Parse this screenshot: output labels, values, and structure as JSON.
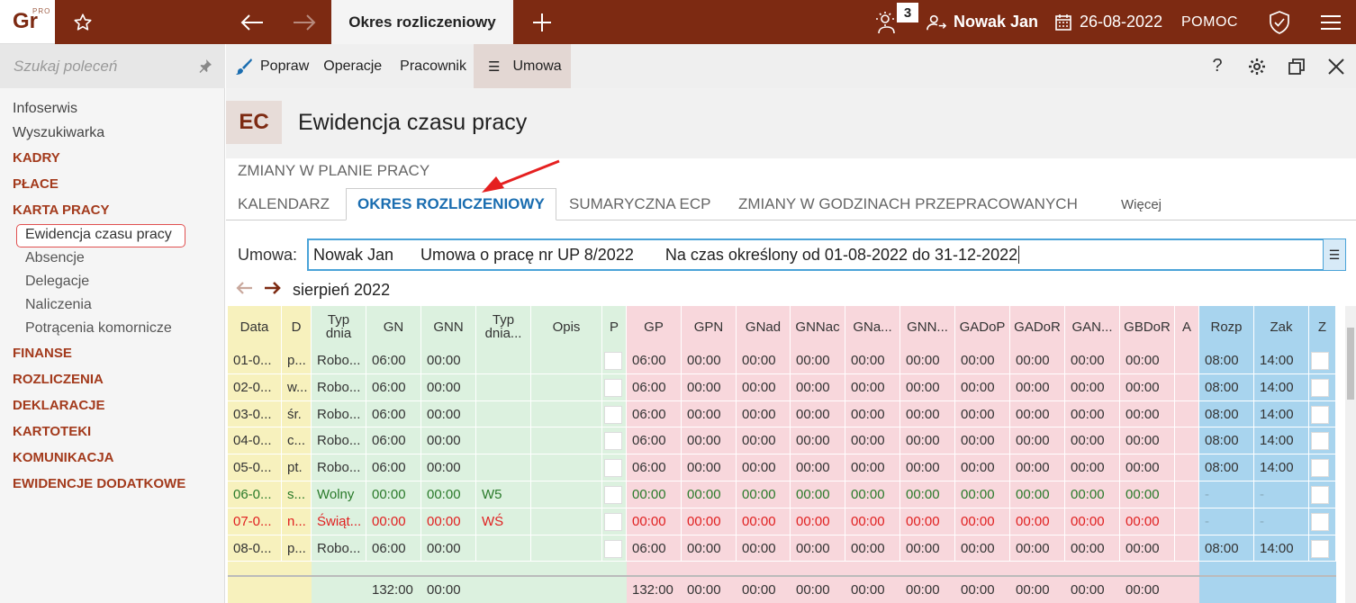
{
  "app": {
    "logo_text": "Gr",
    "logo_badge": "PRO",
    "active_tab": "Okres rozliczeniowy",
    "notifications": "3",
    "user": "Nowak Jan",
    "date": "26-08-2022",
    "help": "POMOC"
  },
  "sidebar": {
    "search_placeholder": "Szukaj poleceń",
    "items": [
      {
        "label": "Infoserwis",
        "kind": "plain"
      },
      {
        "label": "Wyszukiwarka",
        "kind": "plain"
      },
      {
        "label": "KADRY",
        "kind": "sect"
      },
      {
        "label": "PŁACE",
        "kind": "sect"
      },
      {
        "label": "KARTA PRACY",
        "kind": "sect"
      },
      {
        "label": "Ewidencja czasu pracy",
        "kind": "sel"
      },
      {
        "label": "Absencje",
        "kind": "sub"
      },
      {
        "label": "Delegacje",
        "kind": "sub"
      },
      {
        "label": "Naliczenia",
        "kind": "sub"
      },
      {
        "label": "Potrącenia komornicze",
        "kind": "sub"
      },
      {
        "label": "FINANSE",
        "kind": "sect"
      },
      {
        "label": "ROZLICZENIA",
        "kind": "sect"
      },
      {
        "label": "DEKLARACJE",
        "kind": "sect"
      },
      {
        "label": "KARTOTEKI",
        "kind": "sect"
      },
      {
        "label": "KOMUNIKACJA",
        "kind": "sect"
      },
      {
        "label": "EWIDENCJE DODATKOWE",
        "kind": "sect"
      }
    ]
  },
  "toolbar": {
    "popraw": "Popraw",
    "operacje": "Operacje",
    "pracownik": "Pracownik",
    "umowa": "Umowa",
    "help": "?"
  },
  "header": {
    "badge": "EC",
    "title": "Ewidencja czasu pracy"
  },
  "subtabs": {
    "zmiany_plan": "ZMIANY W PLANIE PRACY",
    "kalendarz": "KALENDARZ",
    "okres": "OKRES ROZLICZENIOWY",
    "sumaryczna": "SUMARYCZNA ECP",
    "zmiany_godz": "ZMIANY W GODZINACH PRZEPRACOWANYCH",
    "wiecej": "Więcej"
  },
  "umowa": {
    "label": "Umowa:",
    "value": "Nowak Jan      Umowa o pracę nr UP 8/2022       Na czas określony od 01-08-2022 do 31-12-2022"
  },
  "month": "sierpień 2022",
  "colors": {
    "yellow": "#f7f1bd",
    "green": "#dcf1df",
    "pink": "#f8d7dc",
    "blue": "#a8d4ee",
    "holiday_text": "#e02020",
    "free_text": "#2a7a2a"
  },
  "columns": [
    {
      "key": "data",
      "label": "Data",
      "w": 60,
      "bg": "yellow"
    },
    {
      "key": "d",
      "label": "D",
      "w": 33,
      "bg": "yellow"
    },
    {
      "key": "typ",
      "label": "Typ\ndnia",
      "w": 61,
      "bg": "green"
    },
    {
      "key": "gn",
      "label": "GN",
      "w": 61,
      "bg": "green"
    },
    {
      "key": "gnn",
      "label": "GNN",
      "w": 61,
      "bg": "green"
    },
    {
      "key": "typ2",
      "label": "Typ\ndnia...",
      "w": 61,
      "bg": "green"
    },
    {
      "key": "opis",
      "label": "Opis",
      "w": 79,
      "bg": "green"
    },
    {
      "key": "p",
      "label": "P",
      "w": 27,
      "bg": "green"
    },
    {
      "key": "gp",
      "label": "GP",
      "w": 61,
      "bg": "pink"
    },
    {
      "key": "gpn",
      "label": "GPN",
      "w": 61,
      "bg": "pink"
    },
    {
      "key": "gnad",
      "label": "GNad",
      "w": 60,
      "bg": "pink"
    },
    {
      "key": "gnnac",
      "label": "GNNac",
      "w": 61,
      "bg": "pink"
    },
    {
      "key": "gna",
      "label": "GNa...",
      "w": 61,
      "bg": "pink"
    },
    {
      "key": "gnn2",
      "label": "GNN...",
      "w": 61,
      "bg": "pink"
    },
    {
      "key": "gadop",
      "label": "GADoP",
      "w": 61,
      "bg": "pink"
    },
    {
      "key": "gador",
      "label": "GADoR",
      "w": 61,
      "bg": "pink"
    },
    {
      "key": "gan",
      "label": "GAN...",
      "w": 61,
      "bg": "pink"
    },
    {
      "key": "gbdor",
      "label": "GBDoR",
      "w": 61,
      "bg": "pink"
    },
    {
      "key": "a",
      "label": "A",
      "w": 27,
      "bg": "pink"
    },
    {
      "key": "rozp",
      "label": "Rozp",
      "w": 61,
      "bg": "blue"
    },
    {
      "key": "zak",
      "label": "Zak",
      "w": 61,
      "bg": "blue"
    },
    {
      "key": "z",
      "label": "Z",
      "w": 30,
      "bg": "blue"
    }
  ],
  "rows": [
    {
      "kind": "work",
      "data": "01-0...",
      "d": "p...",
      "typ": "Robo...",
      "gn": "06:00",
      "gnn": "00:00",
      "typ2": "",
      "opis": "",
      "gp": "06:00",
      "gpn": "00:00",
      "gnad": "00:00",
      "gnnac": "00:00",
      "gna": "00:00",
      "gnn2": "00:00",
      "gadop": "00:00",
      "gador": "00:00",
      "gan": "00:00",
      "gbdor": "00:00",
      "a": "",
      "rozp": "08:00",
      "zak": "14:00"
    },
    {
      "kind": "work",
      "data": "02-0...",
      "d": "w...",
      "typ": "Robo...",
      "gn": "06:00",
      "gnn": "00:00",
      "typ2": "",
      "opis": "",
      "gp": "06:00",
      "gpn": "00:00",
      "gnad": "00:00",
      "gnnac": "00:00",
      "gna": "00:00",
      "gnn2": "00:00",
      "gadop": "00:00",
      "gador": "00:00",
      "gan": "00:00",
      "gbdor": "00:00",
      "a": "",
      "rozp": "08:00",
      "zak": "14:00"
    },
    {
      "kind": "work",
      "data": "03-0...",
      "d": "śr.",
      "typ": "Robo...",
      "gn": "06:00",
      "gnn": "00:00",
      "typ2": "",
      "opis": "",
      "gp": "06:00",
      "gpn": "00:00",
      "gnad": "00:00",
      "gnnac": "00:00",
      "gna": "00:00",
      "gnn2": "00:00",
      "gadop": "00:00",
      "gador": "00:00",
      "gan": "00:00",
      "gbdor": "00:00",
      "a": "",
      "rozp": "08:00",
      "zak": "14:00"
    },
    {
      "kind": "work",
      "data": "04-0...",
      "d": "c...",
      "typ": "Robo...",
      "gn": "06:00",
      "gnn": "00:00",
      "typ2": "",
      "opis": "",
      "gp": "06:00",
      "gpn": "00:00",
      "gnad": "00:00",
      "gnnac": "00:00",
      "gna": "00:00",
      "gnn2": "00:00",
      "gadop": "00:00",
      "gador": "00:00",
      "gan": "00:00",
      "gbdor": "00:00",
      "a": "",
      "rozp": "08:00",
      "zak": "14:00"
    },
    {
      "kind": "work",
      "data": "05-0...",
      "d": "pt.",
      "typ": "Robo...",
      "gn": "06:00",
      "gnn": "00:00",
      "typ2": "",
      "opis": "",
      "gp": "06:00",
      "gpn": "00:00",
      "gnad": "00:00",
      "gnnac": "00:00",
      "gna": "00:00",
      "gnn2": "00:00",
      "gadop": "00:00",
      "gador": "00:00",
      "gan": "00:00",
      "gbdor": "00:00",
      "a": "",
      "rozp": "08:00",
      "zak": "14:00"
    },
    {
      "kind": "free",
      "data": "06-0...",
      "d": "s...",
      "typ": "Wolny",
      "gn": "00:00",
      "gnn": "00:00",
      "typ2": "W5",
      "opis": "",
      "gp": "00:00",
      "gpn": "00:00",
      "gnad": "00:00",
      "gnnac": "00:00",
      "gna": "00:00",
      "gnn2": "00:00",
      "gadop": "00:00",
      "gador": "00:00",
      "gan": "00:00",
      "gbdor": "00:00",
      "a": "",
      "rozp": "-",
      "zak": "-"
    },
    {
      "kind": "holiday",
      "data": "07-0...",
      "d": "n...",
      "typ": "Świąt...",
      "gn": "00:00",
      "gnn": "00:00",
      "typ2": "WŚ",
      "opis": "",
      "gp": "00:00",
      "gpn": "00:00",
      "gnad": "00:00",
      "gnnac": "00:00",
      "gna": "00:00",
      "gnn2": "00:00",
      "gadop": "00:00",
      "gador": "00:00",
      "gan": "00:00",
      "gbdor": "00:00",
      "a": "",
      "rozp": "-",
      "zak": "-"
    },
    {
      "kind": "work",
      "data": "08-0...",
      "d": "p...",
      "typ": "Robo...",
      "gn": "06:00",
      "gnn": "00:00",
      "typ2": "",
      "opis": "",
      "gp": "06:00",
      "gpn": "00:00",
      "gnad": "00:00",
      "gnnac": "00:00",
      "gna": "00:00",
      "gnn2": "00:00",
      "gadop": "00:00",
      "gador": "00:00",
      "gan": "00:00",
      "gbdor": "00:00",
      "a": "",
      "rozp": "08:00",
      "zak": "14:00"
    }
  ],
  "footer": {
    "data": "",
    "d": "",
    "typ": "",
    "gn": "132:00",
    "gnn": "00:00",
    "typ2": "",
    "opis": "",
    "p": "",
    "gp": "132:00",
    "gpn": "00:00",
    "gnad": "00:00",
    "gnnac": "00:00",
    "gna": "00:00",
    "gnn2": "00:00",
    "gadop": "00:00",
    "gador": "00:00",
    "gan": "00:00",
    "gbdor": "00:00",
    "a": "",
    "rozp": "",
    "zak": "",
    "z": ""
  }
}
